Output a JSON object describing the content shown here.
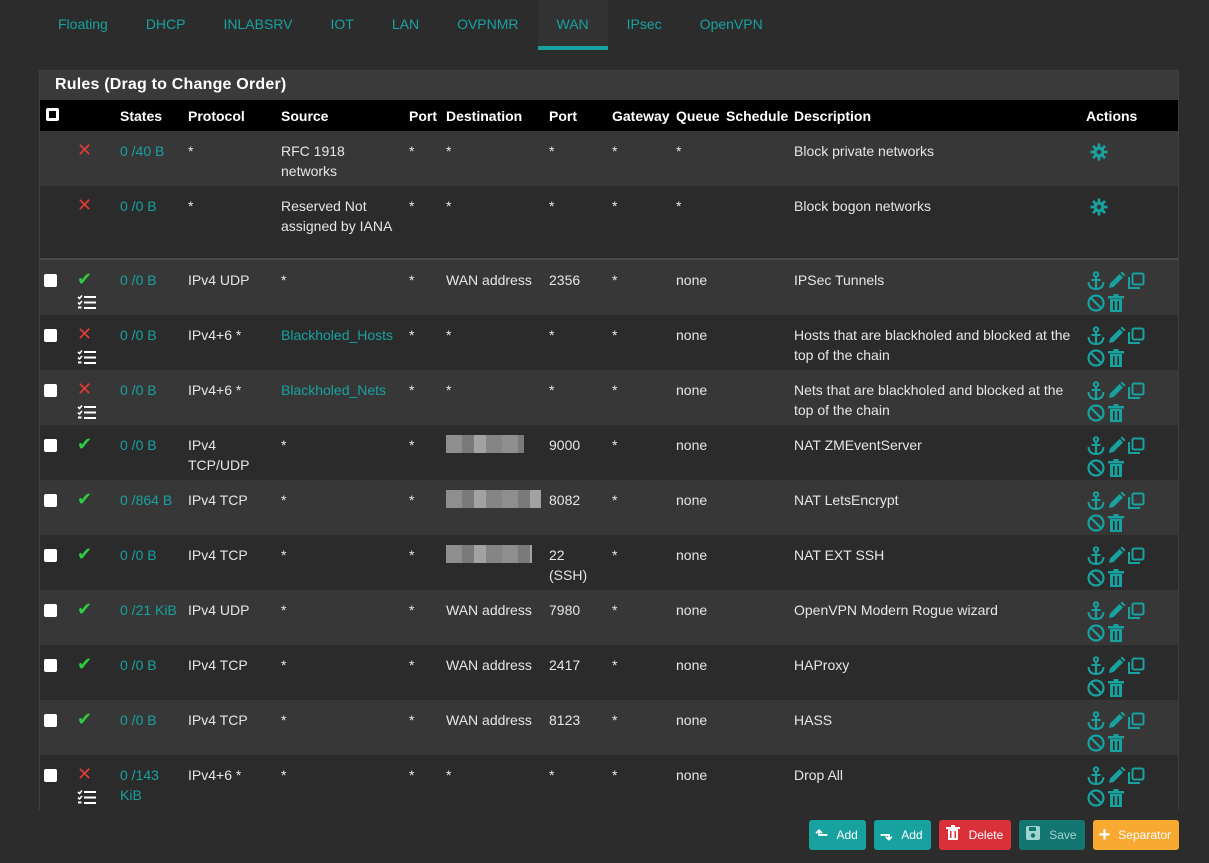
{
  "tabs": [
    {
      "label": "Floating",
      "active": false
    },
    {
      "label": "DHCP",
      "active": false
    },
    {
      "label": "INLABSRV",
      "active": false
    },
    {
      "label": "IOT",
      "active": false
    },
    {
      "label": "LAN",
      "active": false
    },
    {
      "label": "OVPNMR",
      "active": false
    },
    {
      "label": "WAN",
      "active": true
    },
    {
      "label": "IPsec",
      "active": false
    },
    {
      "label": "OpenVPN",
      "active": false
    }
  ],
  "panel": {
    "title": "Rules (Drag to Change Order)"
  },
  "columns": {
    "states": "States",
    "protocol": "Protocol",
    "source": "Source",
    "port": "Port",
    "destination": "Destination",
    "dport": "Port",
    "gateway": "Gateway",
    "queue": "Queue",
    "schedule": "Schedule",
    "description": "Description",
    "actions": "Actions"
  },
  "rows": [
    {
      "status": "block",
      "states": "0 /40 B",
      "protocol": "*",
      "source": "RFC 1918 networks",
      "port": "*",
      "destination": "*",
      "dport": "*",
      "gateway": "*",
      "queue": "*",
      "description": "Block private networks",
      "system": true
    },
    {
      "status": "block",
      "states": "0 /0 B",
      "protocol": "*",
      "source": "Reserved Not assigned by IANA",
      "port": "*",
      "destination": "*",
      "dport": "*",
      "gateway": "*",
      "queue": "*",
      "description": "Block bogon networks",
      "system": true
    },
    {
      "status": "pass",
      "states": "0 /0 B",
      "protocol": "IPv4 UDP",
      "source": "*",
      "port": "*",
      "destination": "WAN address",
      "dport": "2356",
      "gateway": "*",
      "queue": "none",
      "description": "IPSec Tunnels",
      "list": true
    },
    {
      "status": "block",
      "states": "0 /0 B",
      "protocol": "IPv4+6 *",
      "source": "Blackholed_Hosts",
      "source_link": true,
      "port": "*",
      "destination": "*",
      "dport": "*",
      "gateway": "*",
      "queue": "none",
      "description": "Hosts that are blackholed and blocked at the top of the chain",
      "list": true
    },
    {
      "status": "block",
      "states": "0 /0 B",
      "protocol": "IPv4+6 *",
      "source": "Blackholed_Nets",
      "source_link": true,
      "port": "*",
      "destination": "*",
      "dport": "*",
      "gateway": "*",
      "queue": "none",
      "description": "Nets that are blackholed and blocked at the top of the chain",
      "list": true
    },
    {
      "status": "pass",
      "states": "0 /0 B",
      "protocol": "IPv4 TCP/UDP",
      "source": "*",
      "port": "*",
      "destination": "",
      "dest_redacted": true,
      "dport": "9000",
      "gateway": "*",
      "queue": "none",
      "description": "NAT ZMEventServer"
    },
    {
      "status": "pass",
      "states": "0 /864 B",
      "protocol": "IPv4 TCP",
      "source": "*",
      "port": "*",
      "destination": "",
      "dest_redacted": true,
      "dport": "8082",
      "gateway": "*",
      "queue": "none",
      "description": "NAT LetsEncrypt"
    },
    {
      "status": "pass",
      "states": "0 /0 B",
      "protocol": "IPv4 TCP",
      "source": "*",
      "port": "*",
      "destination": "",
      "dest_redacted": true,
      "dport": "22 (SSH)",
      "gateway": "*",
      "queue": "none",
      "description": "NAT EXT SSH"
    },
    {
      "status": "pass",
      "states": "0 /21 KiB",
      "protocol": "IPv4 UDP",
      "source": "*",
      "port": "*",
      "destination": "WAN address",
      "dport": "7980",
      "gateway": "*",
      "queue": "none",
      "description": "OpenVPN Modern Rogue wizard"
    },
    {
      "status": "pass",
      "states": "0 /0 B",
      "protocol": "IPv4 TCP",
      "source": "*",
      "port": "*",
      "destination": "WAN address",
      "dport": "2417",
      "gateway": "*",
      "queue": "none",
      "description": "HAProxy"
    },
    {
      "status": "pass",
      "states": "0 /0 B",
      "protocol": "IPv4 TCP",
      "source": "*",
      "port": "*",
      "destination": "WAN address",
      "dport": "8123",
      "gateway": "*",
      "queue": "none",
      "description": "HASS"
    },
    {
      "status": "block",
      "states": "0 /143 KiB",
      "protocol": "IPv4+6 *",
      "source": "*",
      "port": "*",
      "destination": "*",
      "dport": "*",
      "gateway": "*",
      "queue": "none",
      "description": "Drop All",
      "list": true
    }
  ],
  "buttons": {
    "add_top": "Add",
    "add_bottom": "Add",
    "delete": "Delete",
    "save": "Save",
    "separator": "Separator"
  },
  "colors": {
    "accent": "#17a2a0",
    "block": "#e53935",
    "pass": "#2ecc40"
  }
}
